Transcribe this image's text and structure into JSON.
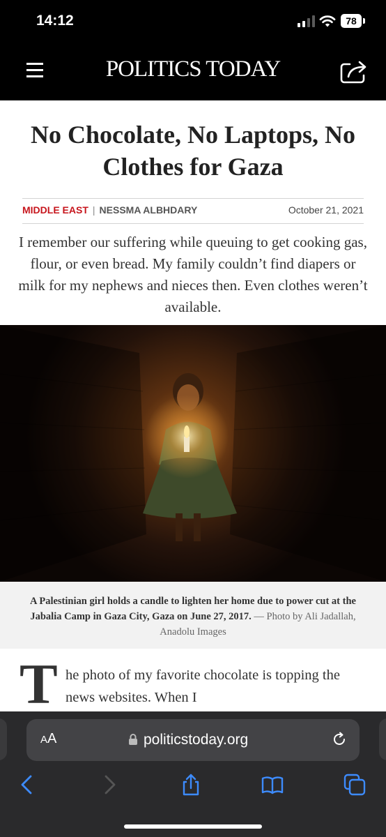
{
  "status_bar": {
    "time": "14:12",
    "battery": "78"
  },
  "header": {
    "brand": "POLITICS TODAY",
    "menu_icon": "hamburger-menu-icon",
    "share_icon": "share-icon"
  },
  "article": {
    "title": "No Chocolate, No Laptops, No Clothes for Gaza",
    "category": "MIDDLE EAST",
    "separator": "|",
    "author": "NESSMA ALBHDARY",
    "date": "October 21, 2021",
    "summary": "I remember our suffering while queuing to get cooking gas, flour, or even bread. My family couldn’t find diapers or milk for my nephews and nieces then. Even clothes weren’t available.",
    "caption": "A Palestinian girl holds a candle to lighten her home due to power cut at the Jabalia Camp in Gaza City, Gaza on June 27, 2017.",
    "caption_credit": "— Photo by Ali Jadallah, Anadolu Images",
    "dropcap": "T",
    "body_start": "he photo of my favorite chocolate is topping the news websites. When I"
  },
  "browser": {
    "aa_small": "A",
    "aa_large": "A",
    "url": "politicstoday.org",
    "toolbar": [
      "back-icon",
      "forward-icon",
      "share-icon",
      "bookmarks-icon",
      "tabs-icon"
    ]
  },
  "colors": {
    "accent": "#c7161d",
    "header_bg": "#000000",
    "safari_blue": "#3d8bfd"
  }
}
